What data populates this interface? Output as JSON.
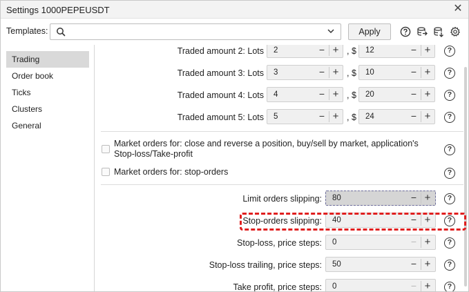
{
  "window": {
    "title": "Settings 1000PEPEUSDT",
    "close_glyph": "✕"
  },
  "templates": {
    "label": "Templates:",
    "value": "",
    "apply_label": "Apply",
    "tool_icons": [
      "help-icon",
      "database-upload-icon",
      "database-download-icon",
      "gear-icon"
    ]
  },
  "sidebar": {
    "items": [
      {
        "label": "Trading",
        "active": true
      },
      {
        "label": "Order book",
        "active": false
      },
      {
        "label": "Ticks",
        "active": false
      },
      {
        "label": "Clusters",
        "active": false
      },
      {
        "label": "General",
        "active": false
      }
    ]
  },
  "traded_amounts": [
    {
      "label": "Traded amount 2: Lots",
      "lots": "2",
      "currency": ", $",
      "usd": "12"
    },
    {
      "label": "Traded amount 3: Lots",
      "lots": "3",
      "currency": ", $",
      "usd": "10"
    },
    {
      "label": "Traded amount 4: Lots",
      "lots": "4",
      "currency": ", $",
      "usd": "20"
    },
    {
      "label": "Traded amount 5: Lots",
      "lots": "5",
      "currency": ", $",
      "usd": "24"
    }
  ],
  "market_orders": [
    {
      "label": "Market orders for: close and reverse a position, buy/sell by market, application's Stop-loss/Take-profit",
      "checked": false
    },
    {
      "label": "Market orders for: stop-orders",
      "checked": false
    }
  ],
  "slipping": [
    {
      "label": "Limit orders slipping:",
      "value": "80"
    },
    {
      "label": "Stop-orders slipping:",
      "value": "40"
    },
    {
      "label": "Stop-loss, price steps:",
      "value": "0"
    },
    {
      "label": "Stop-loss trailing, price steps:",
      "value": "50"
    },
    {
      "label": "Take profit, price steps:",
      "value": "0"
    }
  ],
  "glyphs": {
    "minus": "−",
    "plus": "+",
    "help": "?"
  }
}
